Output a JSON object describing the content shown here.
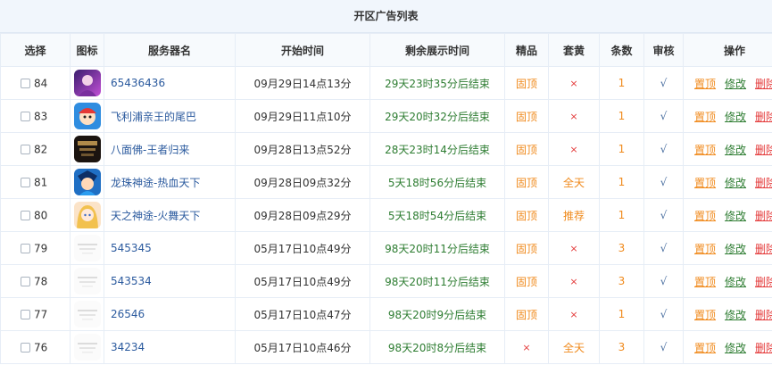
{
  "title": "开区广告列表",
  "columns": [
    "选择",
    "图标",
    "服务器名",
    "开始时间",
    "剩余展示时间",
    "精品",
    "套黄",
    "条数",
    "审核",
    "操作"
  ],
  "colors": {
    "orange": "#f08a1c",
    "green": "#2e7d32",
    "red": "#e43b3b",
    "link": "#2b5a9e"
  },
  "rows": [
    {
      "id": "84",
      "icon": "purple-anime-icon",
      "name": "65436436",
      "start": "09月29日14点13分",
      "remaining": "29天23时35分后结束",
      "jingpin": "固顶",
      "taohuang": "×",
      "count": "1",
      "audit": "√",
      "ops": [
        "置顶",
        "修改",
        "删除"
      ]
    },
    {
      "id": "83",
      "icon": "cartoon-hero-icon",
      "name": "飞利浦亲王的尾巴",
      "start": "09月29日11点10分",
      "remaining": "29天20时32分后结束",
      "jingpin": "固顶",
      "taohuang": "×",
      "count": "1",
      "audit": "√",
      "ops": [
        "置顶",
        "修改",
        "删除"
      ]
    },
    {
      "id": "82",
      "icon": "dark-game-icon",
      "name": "八面佛-王者归来",
      "start": "09月28日13点52分",
      "remaining": "28天23时14分后结束",
      "jingpin": "固顶",
      "taohuang": "×",
      "count": "1",
      "audit": "√",
      "ops": [
        "置顶",
        "修改",
        "删除"
      ]
    },
    {
      "id": "81",
      "icon": "blue-warrior-icon",
      "name": "龙珠神途-热血天下",
      "start": "09月28日09点32分",
      "remaining": "5天18时56分后结束",
      "jingpin": "固顶",
      "taohuang": "全天",
      "count": "1",
      "audit": "√",
      "ops": [
        "置顶",
        "修改",
        "删除"
      ]
    },
    {
      "id": "80",
      "icon": "blonde-girl-icon",
      "name": "天之神途-火舞天下",
      "start": "09月28日09点29分",
      "remaining": "5天18时54分后结束",
      "jingpin": "固顶",
      "taohuang": "推荐",
      "count": "1",
      "audit": "√",
      "ops": [
        "置顶",
        "修改",
        "删除"
      ]
    },
    {
      "id": "79",
      "icon": "placeholder-image-icon",
      "name": "545345",
      "start": "05月17日10点49分",
      "remaining": "98天20时11分后结束",
      "jingpin": "固顶",
      "taohuang": "×",
      "count": "3",
      "audit": "√",
      "ops": [
        "置顶",
        "修改",
        "删除"
      ]
    },
    {
      "id": "78",
      "icon": "placeholder-image-icon",
      "name": "543534",
      "start": "05月17日10点49分",
      "remaining": "98天20时11分后结束",
      "jingpin": "固顶",
      "taohuang": "×",
      "count": "3",
      "audit": "√",
      "ops": [
        "置顶",
        "修改",
        "删除"
      ]
    },
    {
      "id": "77",
      "icon": "placeholder-image-icon",
      "name": "26546",
      "start": "05月17日10点47分",
      "remaining": "98天20时9分后结束",
      "jingpin": "固顶",
      "taohuang": "×",
      "count": "1",
      "audit": "√",
      "ops": [
        "置顶",
        "修改",
        "删除"
      ]
    },
    {
      "id": "76",
      "icon": "placeholder-image-icon",
      "name": "34234",
      "start": "05月17日10点46分",
      "remaining": "98天20时8分后结束",
      "jingpin": "×",
      "taohuang": "全天",
      "count": "3",
      "audit": "√",
      "ops": [
        "置顶",
        "修改",
        "删除"
      ]
    }
  ]
}
